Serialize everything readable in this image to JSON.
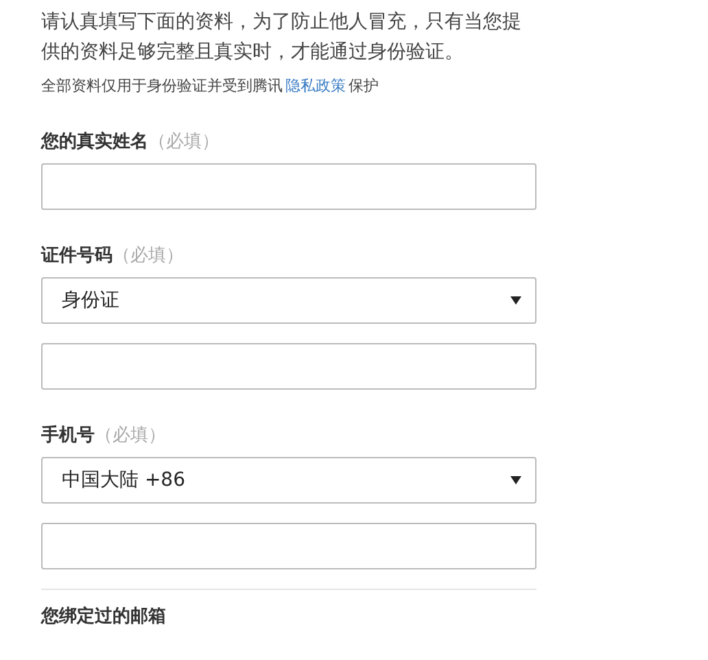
{
  "intro": "请认真填写下面的资料，为了防止他人冒充，只有当您提供的资料足够完整且真实时，才能通过身份验证。",
  "note": {
    "before": "全部资料仅用于身份验证并受到腾讯",
    "link": "隐私政策",
    "after": "保护"
  },
  "sections": [
    {
      "label": "您的真实姓名",
      "hint": "（必填）",
      "fields": [
        {
          "kind": "text"
        }
      ]
    },
    {
      "label": "证件号码",
      "hint": "（必填）",
      "fields": [
        {
          "kind": "select",
          "value": "身份证"
        },
        {
          "kind": "text"
        }
      ]
    },
    {
      "label": "手机号",
      "hint": "（必填）",
      "fields": [
        {
          "kind": "select",
          "value": "中国大陆 +86"
        },
        {
          "kind": "text"
        }
      ]
    }
  ],
  "email_label": "您绑定过的邮箱"
}
